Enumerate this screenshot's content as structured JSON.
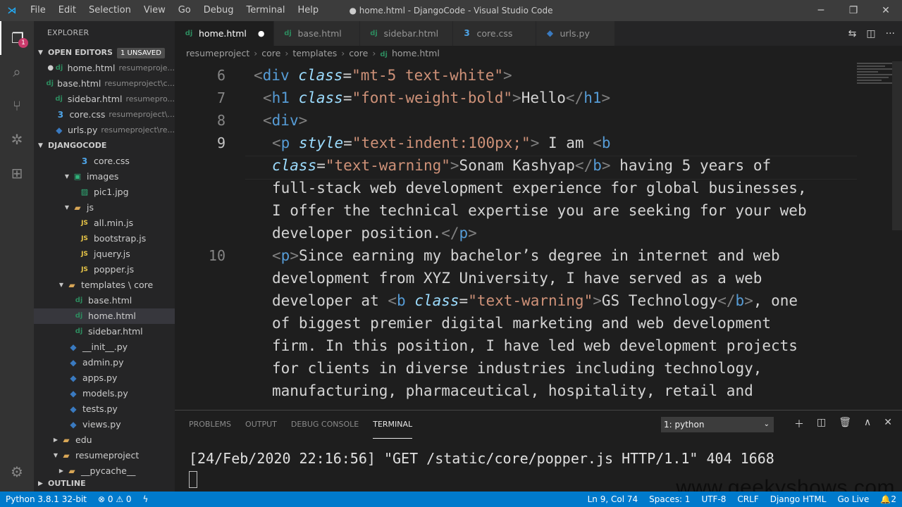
{
  "window": {
    "title": "● home.html - DjangoCode - Visual Studio Code",
    "menu": [
      "File",
      "Edit",
      "Selection",
      "View",
      "Go",
      "Debug",
      "Terminal",
      "Help"
    ],
    "controls": [
      "─",
      "❐",
      "✕"
    ]
  },
  "activity": {
    "scm_badge": "1"
  },
  "explorer": {
    "title": "EXPLORER",
    "open_editors": {
      "label": "OPEN EDITORS",
      "badge": "1 UNSAVED",
      "items": [
        {
          "name": "home.html",
          "path": "resumeproje..."
        },
        {
          "name": "base.html",
          "path": "resumeproject\\c..."
        },
        {
          "name": "sidebar.html",
          "path": "resumepro..."
        },
        {
          "name": "core.css",
          "path": "resumeproject\\..."
        },
        {
          "name": "urls.py",
          "path": "resumeproject\\re..."
        }
      ]
    },
    "project": {
      "label": "DJANGOCODE",
      "items": [
        "core.css",
        "images",
        "pic1.jpg",
        "js",
        "all.min.js",
        "bootstrap.js",
        "jquery.js",
        "popper.js",
        "templates \\ core",
        "base.html",
        "home.html",
        "sidebar.html",
        "__init__.py",
        "admin.py",
        "apps.py",
        "models.py",
        "tests.py",
        "views.py",
        "edu",
        "resumeproject",
        "__pycache__"
      ]
    },
    "outline": "OUTLINE"
  },
  "tabs": [
    "home.html",
    "base.html",
    "sidebar.html",
    "core.css",
    "urls.py"
  ],
  "breadcrumbs": [
    "resumeproject",
    "core",
    "templates",
    "core",
    "home.html"
  ],
  "editor": {
    "line_numbers": [
      "6",
      "7",
      "8",
      "9",
      "10"
    ],
    "lines": {
      "l6": {
        "a": "<",
        "b": "div",
        "c": " class",
        "d": "=",
        "e": "\"mt-5 text-white\"",
        "f": ">"
      },
      "l7": {
        "a": "<",
        "b": "h1",
        "c": " class",
        "d": "=",
        "e": "\"font-weight-bold\"",
        "f": ">",
        "g": "Hello",
        "h": "</",
        "i": "h1",
        "j": ">"
      },
      "l8": {
        "a": "<",
        "b": "div",
        "f": ">"
      },
      "l9a": {
        "a": "<",
        "b": "p",
        "c": " style",
        "d": "=",
        "e": "\"text-indent:100px;\"",
        "f": ">",
        "g": " I am ",
        "h": "<",
        "i": "b"
      },
      "l9b": {
        "c": "class",
        "d": "=",
        "e": "\"text-warning\"",
        "f": ">",
        "g": "Sonam Kashyap",
        "h": "</",
        "i": "b",
        "j": ">",
        "k": " having 5 years of"
      },
      "l9c": "full-stack web development experience for global businesses,",
      "l9d": "I offer the technical expertise you are seeking for your web",
      "l9e": {
        "g": "developer position.",
        "h": "</",
        "i": "p",
        "j": ">"
      },
      "l10a": {
        "a": "<",
        "b": "p",
        "f": ">",
        "g": "Since earning my bachelor’s degree in internet and web"
      },
      "l10b": "development from XYZ University, I have served as a web",
      "l10c": {
        "g": "developer at ",
        "h": "<",
        "i": "b",
        "c": " class",
        "d": "=",
        "e": "\"text-warning\"",
        "f": ">",
        "k": "GS Technology",
        "m": "</",
        "n": "b",
        "o": ">",
        "p": ", one"
      },
      "l10d": "of biggest premier digital marketing and web development",
      "l10e": "firm. In this position, I have led web development projects",
      "l10f": "for clients in diverse industries including technology,",
      "l10g": "manufacturing, pharmaceutical, hospitality, retail and"
    }
  },
  "panel": {
    "tabs": [
      "PROBLEMS",
      "OUTPUT",
      "DEBUG CONSOLE",
      "TERMINAL"
    ],
    "terminal_select": "1: python",
    "terminal_line": "[24/Feb/2020 22:16:56] \"GET /static/core/popper.js HTTP/1.1\" 404 1668"
  },
  "status": {
    "python": "Python 3.8.1 32-bit",
    "errors": "⊗ 0 ⚠ 0",
    "position": "Ln 9, Col 74",
    "spaces": "Spaces: 1",
    "encoding": "UTF-8",
    "eol": "CRLF",
    "language": "Django HTML",
    "golive": "Go Live",
    "bell": "2"
  },
  "watermark": "www.geekyshows.com",
  "colors": {
    "statusbar": "#007acc",
    "accent_warning": "#ce9178",
    "tag": "#569cd6",
    "attr": "#9cdcfe"
  }
}
